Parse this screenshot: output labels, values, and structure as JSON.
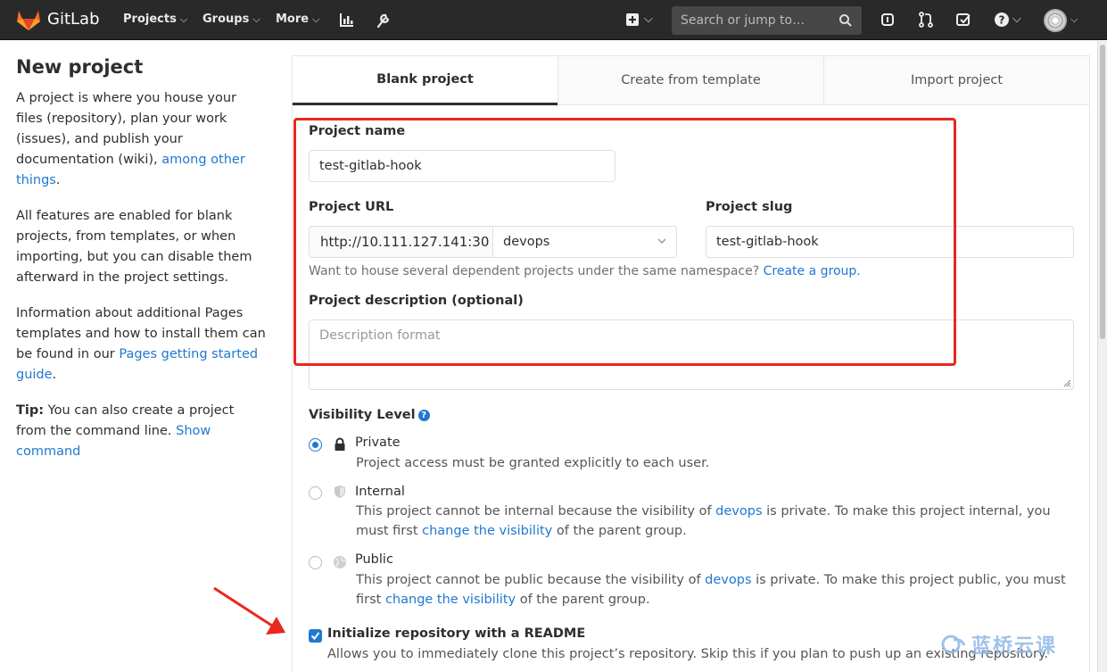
{
  "nav": {
    "brand": "GitLab",
    "projects": "Projects",
    "groups": "Groups",
    "more": "More",
    "search_placeholder": "Search or jump to…"
  },
  "sidebar": {
    "title": "New project",
    "p1_text": "A project is where you house your files (repository), plan your work (issues), and publish your documentation (wiki),",
    "p1_link": "among other things",
    "p1_end": ".",
    "p2_text": "All features are enabled for blank projects, from templates, or when importing, but you can disable them afterward in the project settings.",
    "p3_text": "Information about additional Pages templates and how to install them can be found in our",
    "p3_link": "Pages getting started guide",
    "p3_end": ".",
    "tip_label": "Tip:",
    "tip_text": "You can also create a project from the command line.",
    "tip_link": "Show command"
  },
  "tabs": [
    {
      "label": "Blank project"
    },
    {
      "label": "Create from template"
    },
    {
      "label": "Import project"
    }
  ],
  "form": {
    "project_name_label": "Project name",
    "project_name_value": "test-gitlab-hook",
    "project_url_label": "Project URL",
    "project_url_prefix": "http://10.111.127.141:30",
    "namespace": "devops",
    "project_slug_label": "Project slug",
    "project_slug_value": "test-gitlab-hook",
    "namespace_help": "Want to house several dependent projects under the same namespace?",
    "namespace_help_link": "Create a group.",
    "description_label": "Project description (optional)",
    "description_placeholder": "Description format",
    "visibility_label": "Visibility Level",
    "visibility": [
      {
        "title": "Private",
        "line1": "Project access must be granted explicitly to each user.",
        "selected": true
      },
      {
        "title": "Internal",
        "line1_a": "This project cannot be internal because the visibility of",
        "line1_link": "devops",
        "line1_b": "is private. To make this project internal, you must first",
        "line2_link": "change the visibility",
        "line2_b": "of the parent group.",
        "selected": false
      },
      {
        "title": "Public",
        "line1_a": "This project cannot be public because the visibility of",
        "line1_link": "devops",
        "line1_b": "is private. To make this project public, you must first",
        "line2_link": "change the visibility",
        "line2_b": "of the parent group.",
        "selected": false
      }
    ],
    "readme_label": "Initialize repository with a README",
    "readme_desc": "Allows you to immediately clone this project’s repository. Skip this if you plan to push up an existing repository.",
    "readme_checked": true
  },
  "watermark": "蓝桥云课",
  "colors": {
    "accent": "#1f78d1",
    "nav_bg": "#292929",
    "annotation": "#e8281e"
  }
}
